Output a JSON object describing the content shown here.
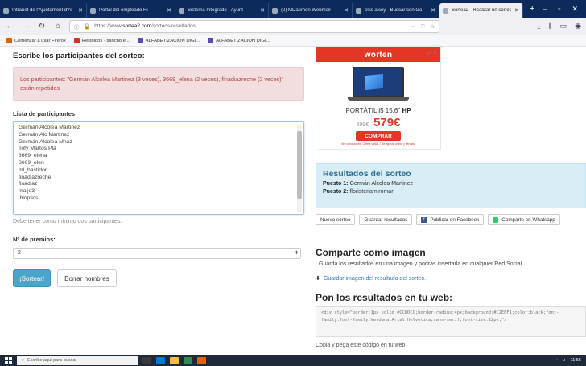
{
  "browser": {
    "tabs": [
      {
        "label": "Intranet de l'Ajuntament d'Al",
        "active": false
      },
      {
        "label": "Portal del empleado Ri",
        "active": false
      },
      {
        "label": "Sistema Integrado - Ayunt",
        "active": false
      },
      {
        "label": "(2) MDaemon Webmail",
        "active": false
      },
      {
        "label": "elks alcoy - Buscar con Go",
        "active": false
      },
      {
        "label": "Sortea2 - Realizar un sorteo",
        "active": true
      }
    ],
    "new_tab": "+",
    "window_buttons": [
      "–",
      "▫",
      "✕"
    ],
    "url_prefix": "https://www.",
    "url_domain": "sortea2.com",
    "url_path": "/sorteos/resultados",
    "url_tail": [
      "···",
      "♡",
      "☆"
    ],
    "bookmarks": [
      {
        "label": "Comenzar a usar Firefox",
        "color": "#e66000"
      },
      {
        "label": "Recibidos - sancho.e...",
        "color": "#d93025"
      },
      {
        "label": "ALFABETIZACION DIGI...",
        "color": "#5b4bb7"
      },
      {
        "label": "ALFABETIZACION DIGI...",
        "color": "#5b4bb7"
      }
    ]
  },
  "form": {
    "heading": "Escribe los participantes del sorteo:",
    "alert": "Los participantes: \"Germán Alcolea Martinez (3 veces), 3669_elena (2 veces), finadiazreche (2 veces)\" están repetidos",
    "list_label": "Lista de participantes:",
    "participants": [
      "Germán Alcolea Martinez",
      "Germán Alc Martinez",
      "Germán Alcolea Mnaz",
      "Tofy Martos Pla",
      "3669_elena",
      "3669_elen",
      "ml_bastidor",
      "finadiazreche",
      "finadiaz",
      "maije3",
      "lbloptics"
    ],
    "hint": "Debe tener como mínimo dos participantes.",
    "premios_label": "Nº de premios:",
    "premios_value": "2",
    "submit_label": "¡Sortear!",
    "clear_label": "Borrar nombres"
  },
  "ad": {
    "brand": "worten",
    "title_prefix": "PORTÁTIL i5 15.6\"",
    "title_suffix": "HP",
    "old_price": "699€",
    "new_price": "579€",
    "buy_label": "COMPRAR",
    "fine_print": "Ver condiciones, Oferta válida 7 de agosto online y tiendas.",
    "close": "▷ ✕"
  },
  "results": {
    "title": "Resultados del sorteo",
    "winners": [
      {
        "label": "Puesto 1:",
        "name": "Germán Alcolea Martinez"
      },
      {
        "label": "Puesto 2:",
        "name": "floristeriamiromar"
      }
    ]
  },
  "share": {
    "new_label": "Nuevo sorteo",
    "save_label": "Guardar resultados",
    "facebook_label": "Publicar en Facebook",
    "whatsapp_label": "Comparte en Whatsapp"
  },
  "image_section": {
    "title": "Comparte como imagen",
    "text": "Guarda los resultados en una imagen y podrás insertarla en cualquier Red Social.",
    "link": "Guardar imagen del resultado del sorteo."
  },
  "web_section": {
    "title": "Pon los resultados en tu web:",
    "code": "<div style=\"border:1px solid #CCDDCC;border-radius:4px;background:#C2E6F1;color:black;font-family:font-family:Verdana,Arial,Helvetica,sans-serif;font-size:12px;\">",
    "copy_text": "Copia y pega este código en tu web"
  },
  "taskbar": {
    "search_placeholder": "Escribe aquí para buscar",
    "clock": "11:56"
  }
}
